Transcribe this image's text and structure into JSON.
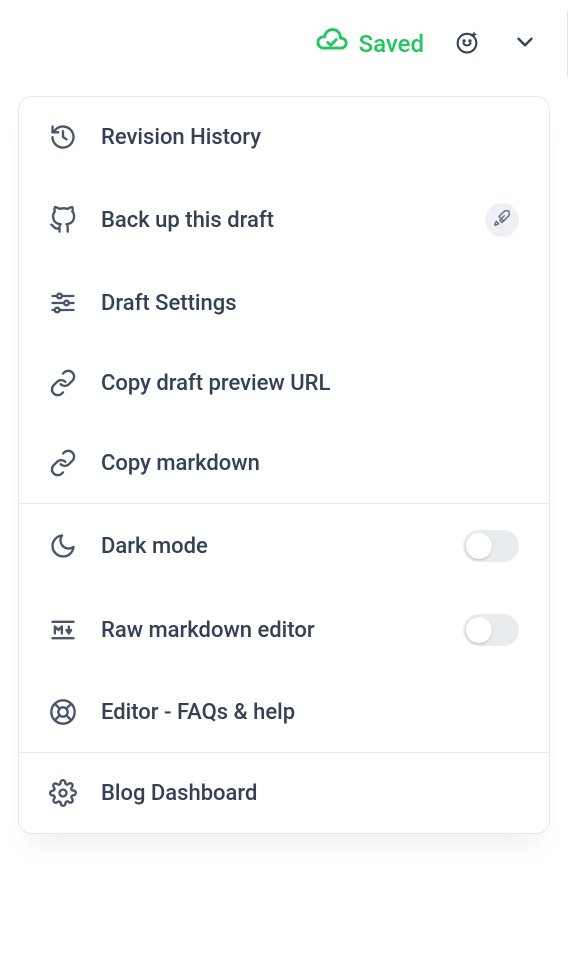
{
  "header": {
    "saved_label": "Saved"
  },
  "menu": {
    "revision_history": "Revision History",
    "backup_draft": "Back up this draft",
    "draft_settings": "Draft Settings",
    "copy_preview_url": "Copy draft preview URL",
    "copy_markdown": "Copy markdown",
    "dark_mode": "Dark mode",
    "raw_markdown": "Raw markdown editor",
    "faqs_help": "Editor - FAQs & help",
    "blog_dashboard": "Blog Dashboard"
  },
  "toggles": {
    "dark_mode": false,
    "raw_markdown": false
  }
}
